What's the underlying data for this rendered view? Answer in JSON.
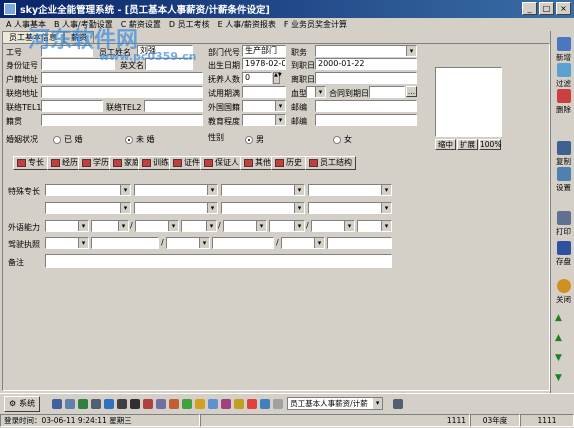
{
  "window": {
    "title": "sky企业全能管理系统 - [员工基本人事薪资/计薪条件设定]",
    "minimize": "_",
    "maximize": "□",
    "close": "×"
  },
  "menu": [
    "A 人事基本",
    "B 人事/考勤设置",
    "C 薪资设置",
    "D 员工考核",
    "E 人事/薪资报表",
    "F 业务员奖金计算"
  ],
  "tabs": [
    "员工基本信息",
    "薪资"
  ],
  "form": {
    "emp_no_label": "工号",
    "emp_name_label": "员工姓名",
    "emp_name_value": "刘强",
    "english_name_label": "英文名",
    "id_label": "身份证号",
    "dept_label": "部门代号",
    "dept_value": "生产部门",
    "position_label": "职务",
    "birth_label": "出生日期",
    "birth_value": "1978-02-02",
    "join_label": "到职日期",
    "join_value": "2000-01-22",
    "dependents_label": "抚养人数",
    "dependents_value": "0",
    "leave_label": "离职日",
    "huji_label": "户籍地址",
    "contact_addr_label": "联络地址",
    "trial_label": "试用期满",
    "blood_label": "血型",
    "contract_label": "合同到期日",
    "tel1_label": "联络TEL1",
    "tel2_label": "联络TEL2",
    "foreign_label": "外国国籍",
    "zip1_label": "邮编",
    "native_label": "籍贯",
    "edu_label": "教育程度",
    "zip2_label": "邮编",
    "marital_label": "婚姻状况",
    "married": "已 婚",
    "single": "未 婚",
    "gender_label": "性别",
    "male": "男",
    "female": "女"
  },
  "photo_buttons": {
    "shrink": "缩中",
    "expand": "扩展",
    "zoom": "100%"
  },
  "subtabs": [
    "专长",
    "经历",
    "学历",
    "家庭",
    "训练",
    "证件",
    "保证人",
    "其他",
    "历史",
    "员工结构"
  ],
  "special": {
    "skills_label": "特殊专长",
    "language_label": "外语能力",
    "license_label": "驾驶执照",
    "remarks_label": "备注"
  },
  "sidebar": [
    "新增",
    "过滤",
    "删除",
    "复制",
    "设置",
    "打印",
    "存盘",
    "关闭"
  ],
  "toolbar": {
    "system": "系统",
    "module_select": "员工基本人事薪资/计薪"
  },
  "status": {
    "login": "登录时间：03-06-11 9:24:11 星期三",
    "code1": "1111",
    "year": "03年度",
    "code2": "1111"
  },
  "watermark": {
    "line1": "河东软件网",
    "line2": "www.pc0359.cn"
  },
  "colors": {
    "titlebar": "#0a246a",
    "background": "#d4d0c8"
  }
}
